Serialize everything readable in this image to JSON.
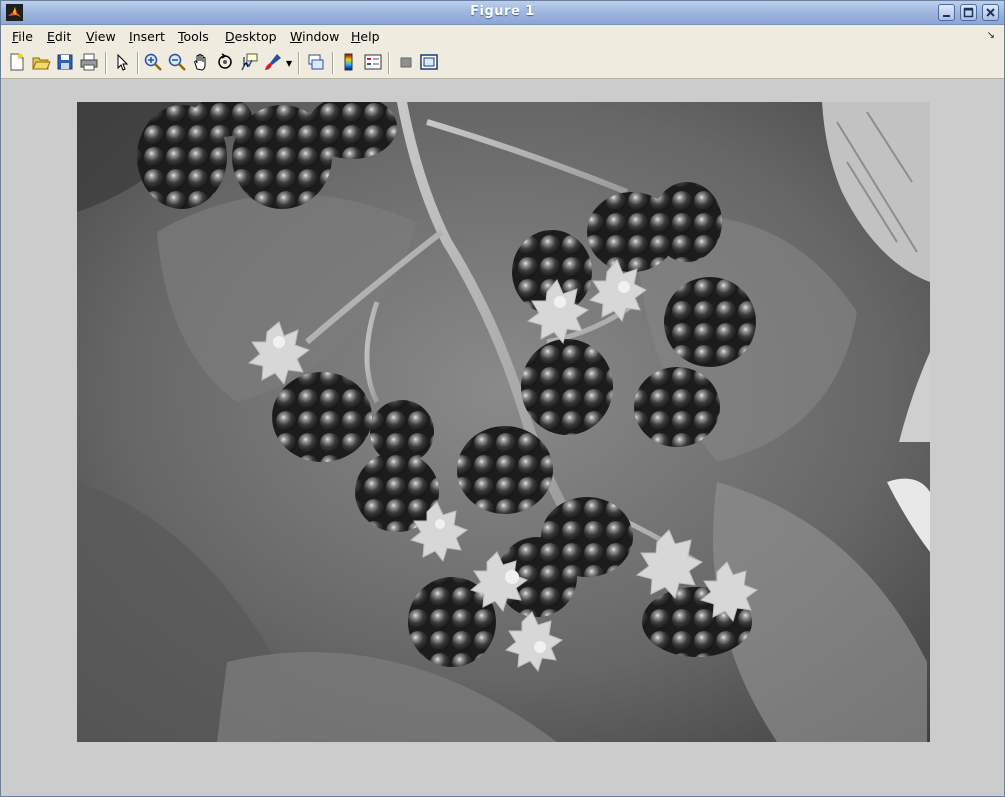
{
  "window": {
    "title": "Figure 1"
  },
  "menubar": {
    "items": [
      {
        "label": "File",
        "accel": "F",
        "rest": "ile"
      },
      {
        "label": "Edit",
        "accel": "E",
        "rest": "dit"
      },
      {
        "label": "View",
        "accel": "V",
        "rest": "iew"
      },
      {
        "label": "Insert",
        "accel": "I",
        "rest": "nsert"
      },
      {
        "label": "Tools",
        "accel": "T",
        "rest": "ools"
      },
      {
        "label": "Desktop",
        "accel": "D",
        "rest": "esktop"
      },
      {
        "label": "Window",
        "accel": "W",
        "rest": "indow"
      },
      {
        "label": "Help",
        "accel": "H",
        "rest": "elp"
      }
    ],
    "dock_icon": "dock-arrow-icon"
  },
  "toolbar": {
    "buttons": [
      "new-figure-icon",
      "open-file-icon",
      "save-icon",
      "print-icon",
      "edit-plot-icon",
      "zoom-in-icon",
      "zoom-out-icon",
      "pan-icon",
      "rotate-3d-icon",
      "data-cursor-icon",
      "brush-icon",
      "link-plot-icon",
      "insert-colorbar-icon",
      "insert-legend-icon",
      "hide-plot-tools-icon",
      "show-plot-tools-icon"
    ]
  },
  "figure": {
    "content": "grayscale-image",
    "colors": {
      "background": "#cccccc",
      "titlebar": "#9fb8df",
      "toolbar": "#efebde"
    }
  }
}
